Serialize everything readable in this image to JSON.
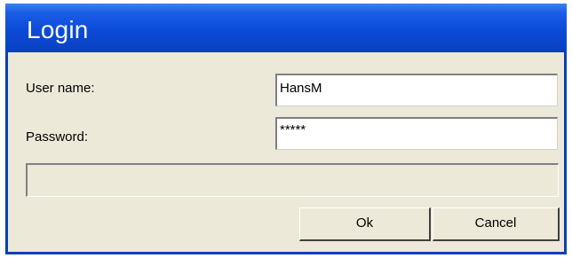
{
  "window": {
    "title": "Login"
  },
  "form": {
    "username_label": "User name:",
    "username_value": "HansM",
    "password_label": "Password:",
    "password_value": "*****"
  },
  "status": {
    "text": ""
  },
  "buttons": {
    "ok_label": "Ok",
    "cancel_label": "Cancel"
  },
  "colors": {
    "titlebar": "#0a44c9",
    "window_background": "#ece9d8",
    "title_text": "#ffffff"
  }
}
